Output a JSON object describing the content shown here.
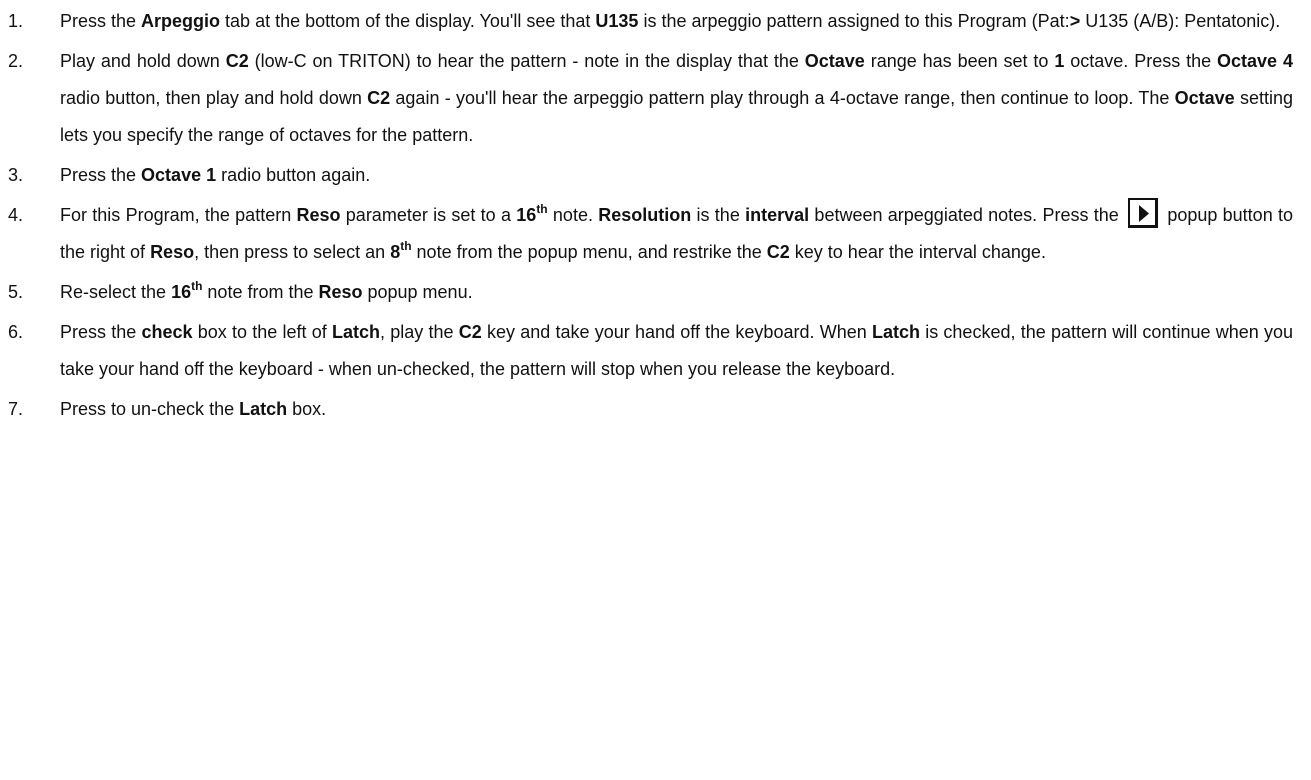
{
  "steps": [
    {
      "number": "1.",
      "parts": [
        {
          "t": "Press the "
        },
        {
          "t": "Arpeggio",
          "b": true
        },
        {
          "t": " tab at the bottom of the display. You'll see that "
        },
        {
          "t": "U135",
          "b": true
        },
        {
          "t": " is the arpeggio pattern assigned to this Program (Pat:"
        },
        {
          "t": ">",
          "b": true
        },
        {
          "t": " U135 (A/B): Pentatonic)."
        }
      ]
    },
    {
      "number": "2.",
      "parts": [
        {
          "t": "Play and hold down "
        },
        {
          "t": "C2",
          "b": true
        },
        {
          "t": " (low-C on TRITON) to hear the pattern - note in the display that the "
        },
        {
          "t": "Octave",
          "b": true
        },
        {
          "t": " range has been set to "
        },
        {
          "t": "1",
          "b": true
        },
        {
          "t": " octave. Press the "
        },
        {
          "t": "Octave 4",
          "b": true
        },
        {
          "t": " radio button, then play and hold down "
        },
        {
          "t": "C2",
          "b": true
        },
        {
          "t": " again - you'll hear the arpeggio pattern play through a 4-octave range, then continue to loop. The "
        },
        {
          "t": "Octave",
          "b": true
        },
        {
          "t": " setting lets you specify the range of octaves for the pattern."
        }
      ]
    },
    {
      "number": "3.",
      "parts": [
        {
          "t": "Press the "
        },
        {
          "t": "Octave 1",
          "b": true
        },
        {
          "t": " radio button again."
        }
      ]
    },
    {
      "number": "4.",
      "parts": [
        {
          "t": "For this Program, the pattern "
        },
        {
          "t": "Reso",
          "b": true
        },
        {
          "t": " parameter is set to a "
        },
        {
          "t": "16",
          "b": true
        },
        {
          "t": "th",
          "sup": true
        },
        {
          "t": " note. "
        },
        {
          "t": "Resolution",
          "b": true
        },
        {
          "t": " is the "
        },
        {
          "t": "interval",
          "b": true
        },
        {
          "t": " between arpeggiated notes. Press the "
        },
        {
          "icon": "play-triangle-icon"
        },
        {
          "t": " popup button to the right of "
        },
        {
          "t": "Reso",
          "b": true
        },
        {
          "t": ", then press to select an "
        },
        {
          "t": "8",
          "b": true
        },
        {
          "t": "th",
          "sup": true
        },
        {
          "t": " note from the popup menu, and restrike the "
        },
        {
          "t": "C2",
          "b": true
        },
        {
          "t": " key to hear the interval change."
        }
      ]
    },
    {
      "number": "5.",
      "parts": [
        {
          "t": "Re-select the "
        },
        {
          "t": "16",
          "b": true
        },
        {
          "t": "th",
          "sup": true
        },
        {
          "t": " note from the "
        },
        {
          "t": "Reso",
          "b": true
        },
        {
          "t": " popup menu."
        }
      ]
    },
    {
      "number": "6.",
      "parts": [
        {
          "t": "Press the "
        },
        {
          "t": "check",
          "b": true
        },
        {
          "t": " box to the left of "
        },
        {
          "t": "Latch",
          "b": true
        },
        {
          "t": ", play the "
        },
        {
          "t": "C2",
          "b": true
        },
        {
          "t": " key and take your hand off the keyboard. When "
        },
        {
          "t": "Latch",
          "b": true
        },
        {
          "t": " is checked, the pattern will continue when you take your hand off the keyboard - when un-checked, the pattern will stop when you release the keyboard."
        }
      ]
    },
    {
      "number": "7.",
      "parts": [
        {
          "t": "Press to un-check the "
        },
        {
          "t": "Latch",
          "b": true
        },
        {
          "t": " box."
        }
      ]
    }
  ]
}
